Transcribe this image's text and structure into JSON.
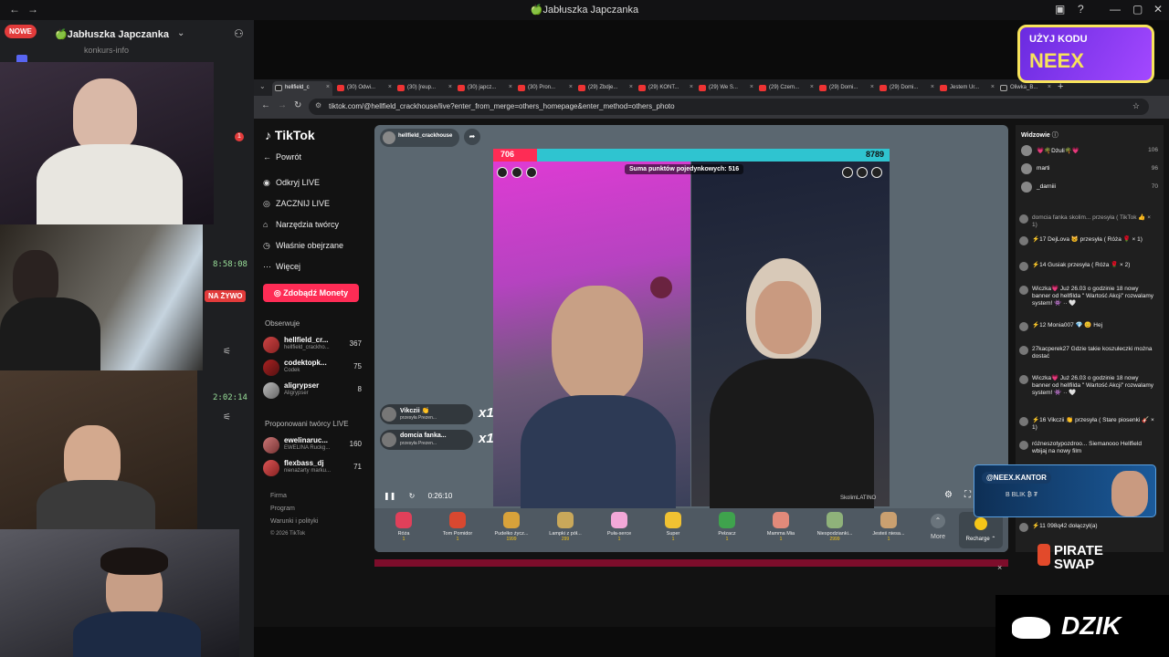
{
  "window": {
    "title": "🍏Jabłuszka Japczanka",
    "nav_back": "←",
    "nav_forward": "→"
  },
  "discord": {
    "new_badge": "NOWE",
    "server_name": "🍏Jabłuszka Japczanka",
    "channel": "konkurs-info",
    "notification_count": "1",
    "live_badge": "NA ŻYWO",
    "timer_1": "8:58:08",
    "timer_2": "2:02:14"
  },
  "browser": {
    "tabs": [
      {
        "label": "hellfield_c"
      },
      {
        "label": "(30) Odwi..."
      },
      {
        "label": "(30) [reup..."
      },
      {
        "label": "(30) japcz..."
      },
      {
        "label": "(30) Pron..."
      },
      {
        "label": "(29) Zbdje..."
      },
      {
        "label": "(29) KONT..."
      },
      {
        "label": "(29) We S..."
      },
      {
        "label": "(29) Czem..."
      },
      {
        "label": "(29) Domi..."
      },
      {
        "label": "(29) Domi..."
      },
      {
        "label": "Jestem Ur..."
      },
      {
        "label": "Oliwka_B..."
      }
    ],
    "url": "tiktok.com/@hellfield_crackhouse/live?enter_from_merge=others_homepage&enter_method=others_photo"
  },
  "tiktok": {
    "logo": "TikTok",
    "nav": {
      "back": "Powrót",
      "discover_live": "Odkryj LIVE",
      "go_live": "ZACZNIJ LIVE",
      "creator_tools": "Narzędzia twórcy",
      "watched": "Właśnie obejrzane",
      "more": "Więcej"
    },
    "coins_button": "Zdobądź Monety",
    "following_label": "Obserwuje",
    "following": [
      {
        "name": "hellfield_cr...",
        "sub": "hellfield_crackho...",
        "count": "367"
      },
      {
        "name": "codektopk...",
        "sub": "Codek",
        "count": "75"
      },
      {
        "name": "aligrypser",
        "sub": "Aligrypser",
        "count": "8"
      }
    ],
    "suggested_label": "Proponowani twórcy LIVE",
    "suggested": [
      {
        "name": "ewelinaruc...",
        "sub": "EWELINA Ruckg...",
        "count": "160"
      },
      {
        "name": "flexbass_dj",
        "sub": "nienażarty marku...",
        "count": "71"
      }
    ],
    "footer": [
      "Firma",
      "Program",
      "Warunki i polityki",
      "© 2026 TikTok"
    ],
    "host": "hellfield_crackhouse",
    "battle": {
      "score_left": "706",
      "score_right": "8789",
      "points_label": "Suma punktów pojedynkowych: 516",
      "watermark": "SkolimLATINO"
    },
    "gift_notices": [
      {
        "name": "Vikczii 👏",
        "sub": "przesyła Prezen...",
        "multiplier": "x1"
      },
      {
        "name": "domcia fanka...",
        "sub": "przesyła Prezen...",
        "multiplier": "x1"
      }
    ],
    "player_time": "0:26:10",
    "gifts": [
      {
        "label": "Róża",
        "price": "1",
        "color": "#e0405a"
      },
      {
        "label": "Tom Pomidor",
        "price": "1",
        "color": "#d94830"
      },
      {
        "label": "Pudełko życz...",
        "price": "1999",
        "color": "#d8a23a"
      },
      {
        "label": "Lampki z pół...",
        "price": "299",
        "color": "#c9a85a"
      },
      {
        "label": "Puła-serce",
        "price": "1",
        "color": "#f3a8d8"
      },
      {
        "label": "Super",
        "price": "1",
        "color": "#f1c232"
      },
      {
        "label": "Pełzacz",
        "price": "1",
        "color": "#3fa34d"
      },
      {
        "label": "Mamma Mia",
        "price": "1",
        "color": "#e28a7a"
      },
      {
        "label": "Niespodzianki...",
        "price": "2999",
        "color": "#8fb27a"
      },
      {
        "label": "Jesteś niesa...",
        "price": "1",
        "color": "#caa070"
      }
    ],
    "more_label": "More",
    "recharge_label": "Recharge ⌃"
  },
  "chat": {
    "viewers_title": "Widzowie",
    "viewers": [
      {
        "name": "💗🌴Dżuli🌴💗",
        "count": "106"
      },
      {
        "name": "marti",
        "count": "96"
      },
      {
        "name": "_darniii",
        "count": "70"
      }
    ],
    "messages": [
      {
        "text": "domcia fanka skolim... przesyła ( TikTok 👍 × 1)"
      },
      {
        "text": "⚡17 DejLova 🐱 przesyła ( Róża 🌹 × 1)"
      },
      {
        "text": "⚡14 Gusiak przesyła ( Róża 🌹 × 2)"
      },
      {
        "text": "Wiczka💗 Już 26.03 o godzinie 18 nowy banner od hellfilda \" Wartość Akcji\" rozwalamy system! 👾 ·· 🤍"
      },
      {
        "text": "⚡12 Monia007 💎 😊 Hej"
      },
      {
        "text": "27kacperek27 Gdzie takie koszuleczki można dostać"
      },
      {
        "text": "Wiczka💗 Już 26.03 o godzinie 18 nowy banner od hellfilda \" Wartość Akcji\" rozwalamy system! 👾 ·· 🤍"
      },
      {
        "text": "⚡16 Vikczii 👏 przesyła ( Stare piosenki 🎸 × 1)"
      },
      {
        "text": "różneszotypozdroo... Siemanooo Hellfield wbijaj na nowy film"
      },
      {
        "text": "⚡11 098q42 dołączył(a)"
      }
    ]
  },
  "overlays": {
    "promo_line1": "UŻYJ KODU",
    "promo_line2": "NEEX",
    "kantor_handle": "@NEEX.KANTOR",
    "kantor_sub": "B BLIK ₿ ₮",
    "pirate": "PIRATE SWAP",
    "dzik": "DZIK"
  }
}
